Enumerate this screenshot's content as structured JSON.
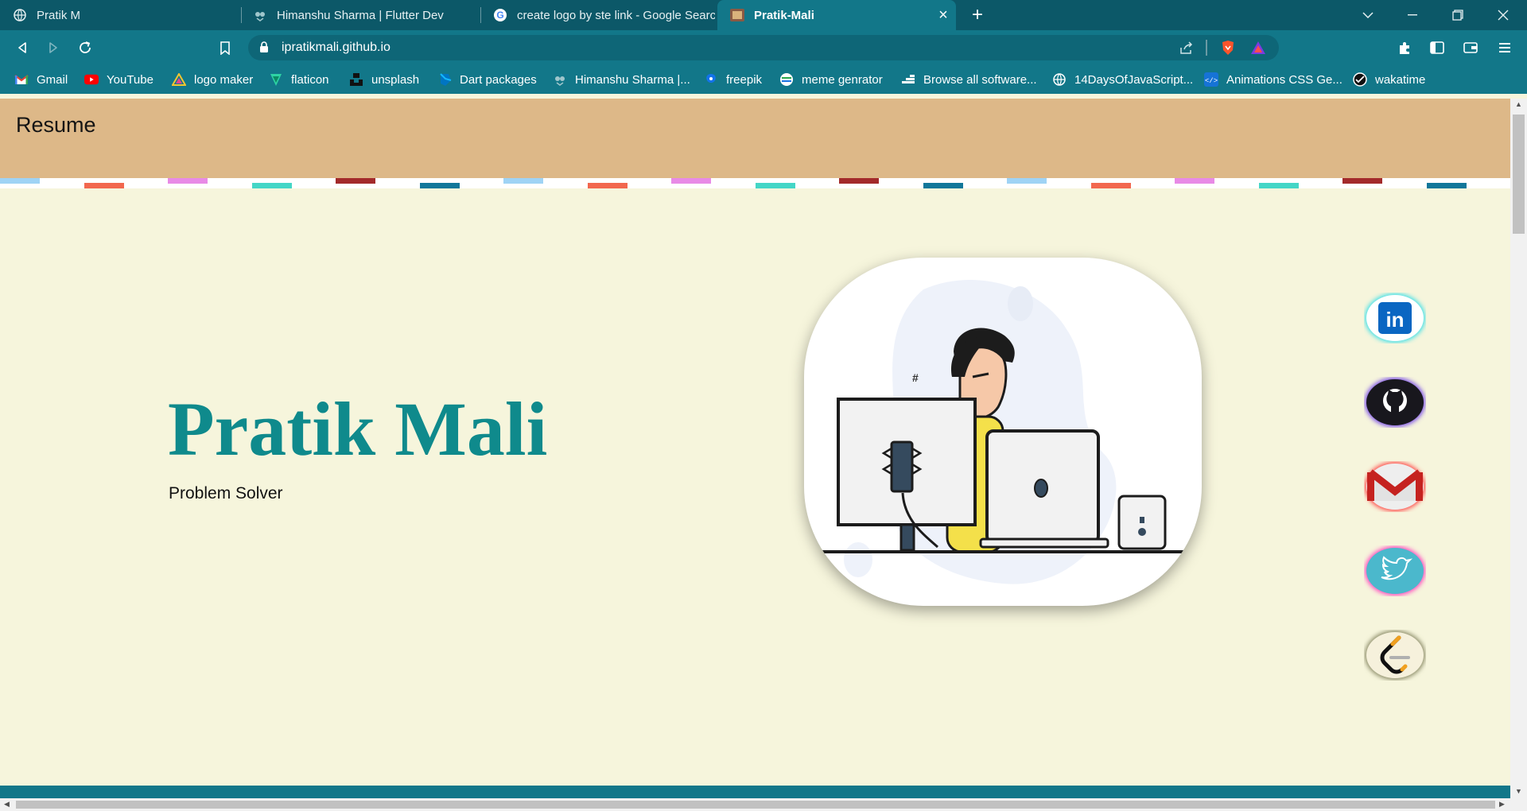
{
  "browser": {
    "tabs": [
      {
        "title": "Pratik M",
        "icon": "globe-icon",
        "active": false
      },
      {
        "title": "Himanshu Sharma | Flutter Dev",
        "icon": "owl-icon",
        "active": false
      },
      {
        "title": "create logo by ste link - Google Search",
        "icon": "google-icon",
        "active": false
      },
      {
        "title": "Pratik-Mali",
        "icon": "site-favicon",
        "active": true
      }
    ],
    "url": "ipratikmali.github.io",
    "bookmarks": [
      {
        "label": "Gmail",
        "icon": "gmail-icon"
      },
      {
        "label": "YouTube",
        "icon": "youtube-icon"
      },
      {
        "label": "logo maker",
        "icon": "logo-maker-icon"
      },
      {
        "label": "flaticon",
        "icon": "flaticon-icon"
      },
      {
        "label": "unsplash",
        "icon": "unsplash-icon"
      },
      {
        "label": "Dart packages",
        "icon": "dart-icon"
      },
      {
        "label": "Himanshu Sharma |...",
        "icon": "owl-icon"
      },
      {
        "label": "freepik",
        "icon": "freepik-icon"
      },
      {
        "label": "meme genrator",
        "icon": "meme-icon"
      },
      {
        "label": "Browse all software...",
        "icon": "software-icon"
      },
      {
        "label": "14DaysOfJavaScript...",
        "icon": "globe-icon"
      },
      {
        "label": "Animations CSS Ge...",
        "icon": "code-icon"
      },
      {
        "label": "wakatime",
        "icon": "wakatime-icon"
      }
    ]
  },
  "page": {
    "brand": "Resume",
    "name": "Pratik Mali",
    "role": "Problem Solver",
    "social": [
      {
        "name": "linkedin",
        "icon": "linkedin-icon",
        "glow": "#3fe0e8"
      },
      {
        "name": "github",
        "icon": "github-icon",
        "glow": "#7a4ee8"
      },
      {
        "name": "gmail",
        "icon": "gmail-icon",
        "glow": "#ff4a4a"
      },
      {
        "name": "twitter",
        "icon": "twitter-icon",
        "glow": "#ff4ac0"
      },
      {
        "name": "leetcode",
        "icon": "leetcode-icon",
        "glow": "#9a9a70"
      }
    ]
  },
  "colors": {
    "chrome": "#127789",
    "chrome_dark": "#0c5868",
    "header": "#ddb888",
    "background": "#f6f5dc",
    "name": "#0f8a8c",
    "stripe": [
      "#9fd3f5",
      "#f2674e",
      "#e88ae6",
      "#44d6c6",
      "#a32a2a",
      "#11779a"
    ]
  }
}
